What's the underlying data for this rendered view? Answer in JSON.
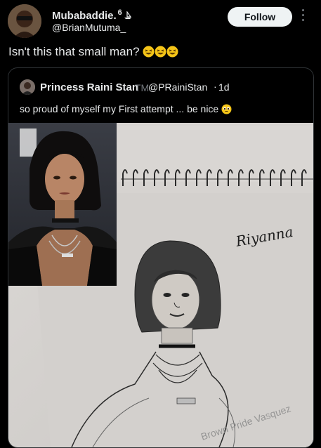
{
  "post": {
    "author_name": "Mubabaddie.",
    "badge": "6",
    "author_handle": "@BrianMutuma_",
    "follow_label": "Follow",
    "text": "Isn't this that small man?",
    "emojis": [
      "grinning-squint-emoji",
      "grinning-squint-emoji",
      "grinning-squint-emoji"
    ]
  },
  "quote": {
    "author_name": "Princess Raini Stan",
    "tm": "TM",
    "author_handle": "@PRainiStan",
    "separator": "·",
    "time": "1d",
    "text": "so proud of myself my First attempt ... be nice",
    "emoji": "pleading-face-emoji",
    "media": {
      "signature": "Riyanna",
      "watermark": "Brown Pride Vasquez"
    }
  },
  "colors": {
    "background": "#000000",
    "text": "#e7e9ea",
    "muted": "#71767b",
    "follow_bg": "#eff3f4",
    "border": "#2f3336"
  }
}
